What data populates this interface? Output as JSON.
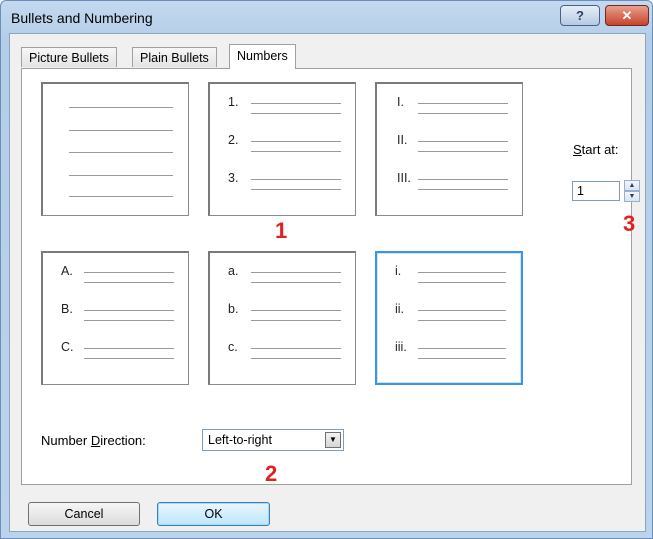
{
  "window": {
    "title": "Bullets and Numbering",
    "help_glyph": "?",
    "close_glyph": "✕"
  },
  "tabs": [
    {
      "label": "Picture Bullets",
      "active": false
    },
    {
      "label": "Plain Bullets",
      "active": false
    },
    {
      "label": "Numbers",
      "active": true
    }
  ],
  "styles": [
    {
      "id": "none",
      "markers": [
        "",
        "",
        "",
        "",
        ""
      ]
    },
    {
      "id": "arabic",
      "markers": [
        "1.",
        "2.",
        "3."
      ]
    },
    {
      "id": "upper-roman",
      "markers": [
        "I.",
        "II.",
        "III."
      ]
    },
    {
      "id": "upper-alpha",
      "markers": [
        "A.",
        "B.",
        "C."
      ]
    },
    {
      "id": "lower-alpha",
      "markers": [
        "a.",
        "b.",
        "c."
      ]
    },
    {
      "id": "lower-roman",
      "markers": [
        "i.",
        "ii.",
        "iii."
      ],
      "selected": true
    }
  ],
  "start_at": {
    "label_prefix": "",
    "label_accel": "S",
    "label_rest": "tart at:",
    "value": "1",
    "up_glyph": "▲",
    "down_glyph": "▼"
  },
  "number_direction": {
    "label_before": "Number ",
    "label_accel": "D",
    "label_after": "irection:",
    "value": "Left-to-right",
    "arrow_glyph": "▼"
  },
  "callouts": [
    "1",
    "2",
    "3"
  ],
  "buttons": {
    "cancel": "Cancel",
    "ok": "OK"
  },
  "colors": {
    "callout": "#e32020",
    "selection": "#3d95e0"
  }
}
